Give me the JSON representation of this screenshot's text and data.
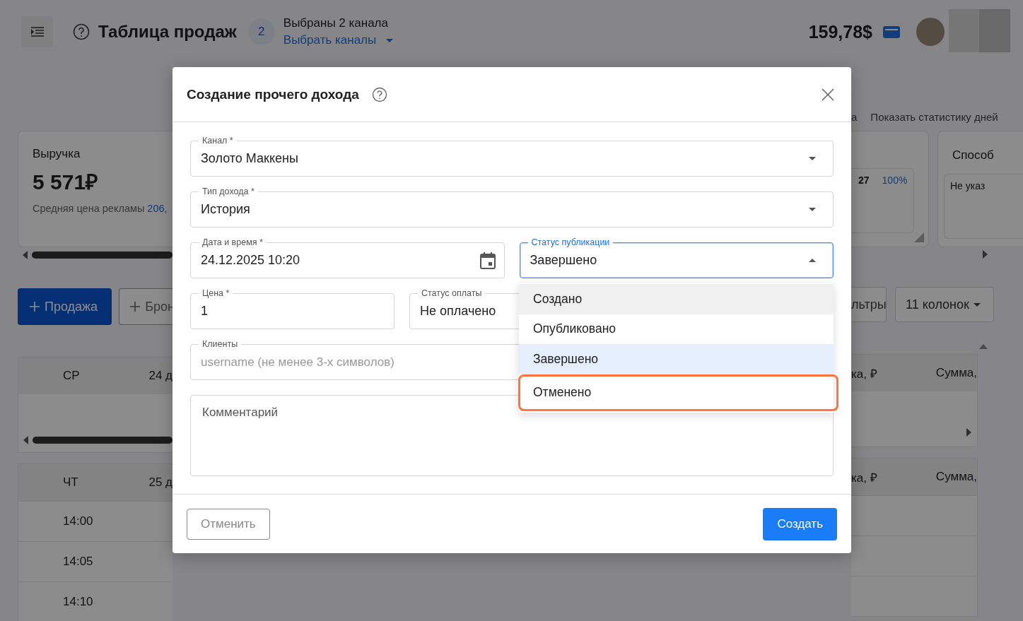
{
  "header": {
    "title": "Таблица продаж",
    "channel_count": "2",
    "channels_selected": "Выбраны 2 канала",
    "choose_channels": "Выбрать каналы",
    "balance": "159,78$"
  },
  "stats_links": {
    "cut_link": "а",
    "show_day_stats": "Показать статистику дней"
  },
  "revenue_card": {
    "title": "Выручка",
    "value": "5 571₽",
    "avg_label": "Средняя цена рекламы",
    "avg_value": "206,"
  },
  "share_card": {
    "count": "27",
    "percent": "100%"
  },
  "payment_card": {
    "title": "Способ",
    "value": "Не указ"
  },
  "toolbar": {
    "sale_button": "Продажа",
    "booking_button": "Брон",
    "filters_button": "льтры",
    "columns_select": "11 колонок"
  },
  "tables": [
    {
      "day": "СР",
      "date": "24 д",
      "column_3": "ка, ₽",
      "column_4": "Сумма,"
    },
    {
      "day": "ЧТ",
      "date": "25 д",
      "column_3": "ка, ₽",
      "column_4": "Сумма,",
      "rows": [
        "14:00",
        "14:05",
        "14:10"
      ]
    }
  ],
  "modal": {
    "title": "Создание прочего дохода",
    "field_rows": [
      [
        {
          "kind": "select",
          "label": "Канал *",
          "value": "Золото Маккены",
          "expanded": false
        }
      ],
      [
        {
          "kind": "select",
          "label": "Тип дохода *",
          "value": "История",
          "expanded": false
        }
      ],
      [
        {
          "kind": "date",
          "label": "Дата и время *",
          "value": "24.12.2025 10:20",
          "expanded": false
        },
        {
          "kind": "select",
          "label": "Статус публикации",
          "value": "Завершено",
          "expanded": true
        }
      ],
      [
        {
          "kind": "text",
          "label": "Цена *",
          "value": "1",
          "expanded": false
        },
        {
          "kind": "text",
          "label": "Статус оплаты",
          "value": "Не оплачено",
          "expanded": false
        }
      ],
      [
        {
          "kind": "text",
          "label": "Клиенты",
          "placeholder": "username (не менее 3-х символов)",
          "expanded": false
        }
      ],
      [
        {
          "kind": "textarea",
          "placeholder": "Комментарий",
          "expanded": false
        }
      ]
    ],
    "status_menu": [
      {
        "label": "Создано",
        "selected": false,
        "hovered": true,
        "outlined": false
      },
      {
        "label": "Опубликовано",
        "selected": false,
        "hovered": false,
        "outlined": false
      },
      {
        "label": "Завершено",
        "selected": true,
        "hovered": false,
        "outlined": false
      },
      {
        "label": "Отменено",
        "selected": false,
        "hovered": false,
        "outlined": true
      }
    ],
    "cancel_button": "Отменить",
    "submit_button": "Создать"
  }
}
